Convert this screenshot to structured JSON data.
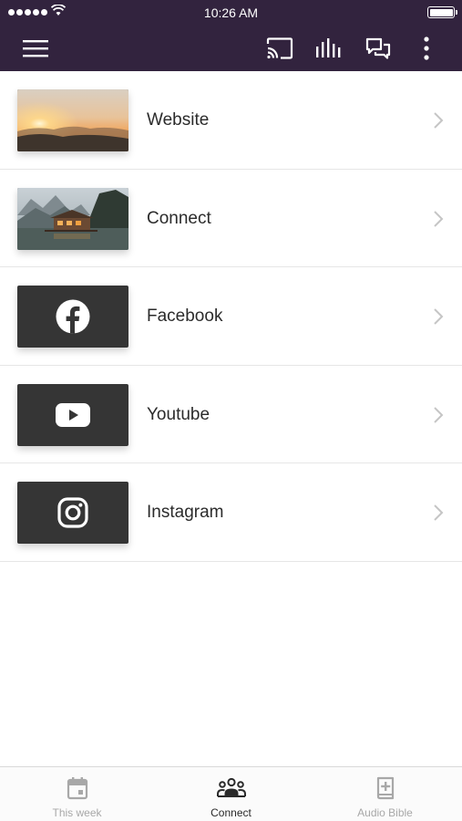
{
  "status_bar": {
    "time": "10:26 AM"
  },
  "toolbar": {
    "menu_icon": "hamburger-menu-icon",
    "cast_icon": "cast-icon",
    "audio_icon": "audio-bars-icon",
    "chat_icon": "chat-bubbles-icon",
    "more_icon": "more-vertical-icon"
  },
  "colors": {
    "header_bg": "#32233e",
    "tile_bg": "#353535",
    "active_tab": "#2a2a2a",
    "inactive_tab": "#a8a8a8"
  },
  "items": [
    {
      "label": "Website",
      "thumb": "sunset-photo"
    },
    {
      "label": "Connect",
      "thumb": "lake-house-photo"
    },
    {
      "label": "Facebook",
      "thumb": "facebook-icon"
    },
    {
      "label": "Youtube",
      "thumb": "youtube-icon"
    },
    {
      "label": "Instagram",
      "thumb": "instagram-icon"
    }
  ],
  "tabs": [
    {
      "label": "This week",
      "icon": "calendar-icon",
      "active": false
    },
    {
      "label": "Connect",
      "icon": "people-group-icon",
      "active": true
    },
    {
      "label": "Audio Bible",
      "icon": "bible-plus-icon",
      "active": false
    }
  ]
}
